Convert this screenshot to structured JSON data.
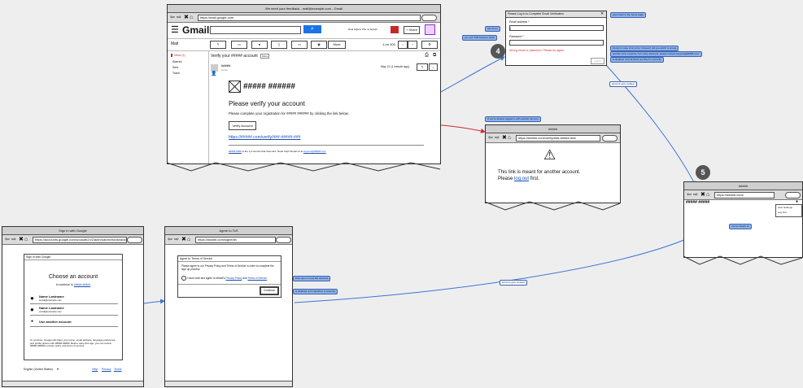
{
  "gmail": {
    "window_title": "We need your feedback - mail@example.com - Gmail",
    "url": "https://mail.google.com",
    "logo": "Gmail",
    "user_name": "Dual Hiljami Pho ne Egretri",
    "share_label": "+ Share",
    "mail_label": "Mail",
    "more_label": "More",
    "pager": "1-no 000",
    "sidebar": [
      "Inbox (1)",
      "Starred",
      "Sent",
      "Trash"
    ],
    "subject": "Verify your ##### account",
    "inbox_tag": "Inbox",
    "sender": "#####",
    "to_line": "to me",
    "date": "May 12 (1 minute ago)",
    "email_logo": "##### ######",
    "heading": "Please verify your account",
    "body": "Please complete your registration for ##### ###### by clicking the link below.",
    "button": "Verify Account",
    "link": "https://#####.com/verify/###-#####-###",
    "footer_link": "#####.####",
    "footer": "is the xyz service that does abc. Need help? Email us at",
    "footer_email": "support@#####.com"
  },
  "login_modal": {
    "title": "Please Log In to Complete Email Verification",
    "email_label": "Email address *",
    "password_label": "Password *",
    "error": "Wrong email or password. Please try again.",
    "login_button": "Log In",
    "notes_left": [
      "has focus",
      "you can TAB between fields"
    ],
    "notes_right": [
      "goes back to the home page",
      "shown in case of an error. It doesn't tell you which is wrong",
      "another error could be \"too many attempts, please contact support@#####.com\"",
      "is disabled until all fields are filled in correctly"
    ],
    "arrow_note": "account gets verified"
  },
  "wrong_account": {
    "note": "If you're already logged in with another account",
    "title": "#####",
    "url": "https://#####.com/verify/###-#####-###",
    "message_line1": "This link is meant for another account.",
    "message_prefix": "Please",
    "logout_link": "log out",
    "message_suffix": "first."
  },
  "app_screen": {
    "title": "#####",
    "url": "https://#####.com/",
    "logo": "##### #####",
    "menu": [
      "User Settings",
      "Log Out"
    ],
    "toast": "You've Really Hi"
  },
  "google_signin": {
    "window_title": "Sign in with Google",
    "url": "https://accounts.google.com/o/oauth2/v2/auth/oauthchooseaccount",
    "header": "Sign in with Google",
    "title": "Choose an account",
    "subtitle": "to continue to",
    "subtitle_link": "#####.#####",
    "accounts": [
      {
        "name": "Name Lastname",
        "email": "email@example.com"
      },
      {
        "name": "Name Lastname",
        "email": "email@example.com"
      }
    ],
    "another": "Use another account",
    "disclaimer": "To continue, Google will share your name, email address, language preference, and profile picture with ##### #####. Before using this app, you can review ##### #####'s privacy policy and terms of service.",
    "language": "English (United States)",
    "footer_links": [
      "Help",
      "Privacy",
      "Terms"
    ]
  },
  "tos": {
    "window_title": "Agree to ToS",
    "url": "https://#####.com/signedin",
    "modal_title": "Agree to Terms of Service",
    "intro": "Please agree to our Privacy Policy and Terms of Service in order to complete the sign up process.",
    "checkbox_text": "I have read and agree to #####'s",
    "privacy_link": "Privacy Policy",
    "and": "and",
    "terms_link": "Terms of Service",
    "continue": "Continue",
    "notes": [
      "links open in new tab windows",
      "is disabled until checkbox is selected"
    ],
    "arrow_note": "account gets created"
  },
  "badges": [
    "4",
    "5"
  ],
  "colors": {
    "accent": "#1a73e8",
    "annotation": "#8fb3e8",
    "error": "#d93025",
    "arrow_blue": "#3b74d8",
    "arrow_red": "#d22b2b"
  },
  "icons": [
    "hamburger-icon",
    "search-icon",
    "back-icon",
    "forward-icon",
    "close-icon",
    "home-icon",
    "warning-icon",
    "avatar-icon",
    "image-placeholder-icon",
    "gear-icon",
    "print-icon",
    "reply-icon"
  ]
}
